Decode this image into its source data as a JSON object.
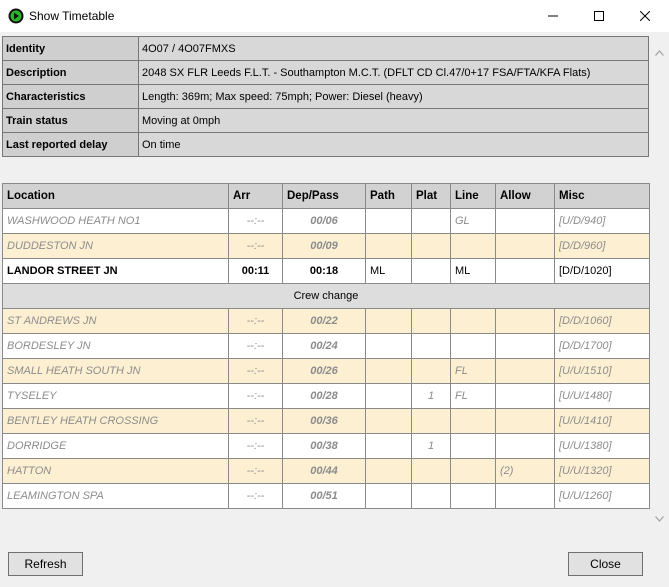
{
  "window": {
    "title": "Show Timetable"
  },
  "summary": [
    {
      "label": "Identity",
      "value": "4O07 / 4O07FMXS"
    },
    {
      "label": "Description",
      "value": "2048 SX FLR Leeds F.L.T. - Southampton M.C.T. (DFLT CD Cl.47/0+17 FSA/FTA/KFA Flats)"
    },
    {
      "label": "Characteristics",
      "value": "Length: 369m; Max speed: 75mph; Power: Diesel (heavy)"
    },
    {
      "label": "Train status",
      "value": "Moving at 0mph"
    },
    {
      "label": "Last reported delay",
      "value": "On time"
    }
  ],
  "columns": [
    "Location",
    "Arr",
    "Dep/Pass",
    "Path",
    "Plat",
    "Line",
    "Allow",
    "Misc"
  ],
  "crew_change": "Crew change",
  "rows": [
    {
      "location": "WASHWOOD HEATH NO1",
      "arr": "--:--",
      "dep": "00/06",
      "path": "",
      "plat": "",
      "line": "GL",
      "allow": "",
      "misc": "[U/D/940]"
    },
    {
      "location": "DUDDESTON JN",
      "arr": "--:--",
      "dep": "00/09",
      "path": "",
      "plat": "",
      "line": "",
      "allow": "",
      "misc": "[D/D/960]"
    },
    {
      "location": "LANDOR STREET JN",
      "arr": "00:11",
      "dep": "00:18",
      "path": "ML",
      "plat": "",
      "line": "ML",
      "allow": "",
      "misc": "[D/D/1020]"
    },
    {
      "location": "ST ANDREWS JN",
      "arr": "--:--",
      "dep": "00/22",
      "path": "",
      "plat": "",
      "line": "",
      "allow": "",
      "misc": "[D/D/1060]"
    },
    {
      "location": "BORDESLEY JN",
      "arr": "--:--",
      "dep": "00/24",
      "path": "",
      "plat": "",
      "line": "",
      "allow": "",
      "misc": "[D/D/1700]"
    },
    {
      "location": "SMALL HEATH SOUTH JN",
      "arr": "--:--",
      "dep": "00/26",
      "path": "",
      "plat": "",
      "line": "FL",
      "allow": "",
      "misc": "[U/U/1510]"
    },
    {
      "location": "TYSELEY",
      "arr": "--:--",
      "dep": "00/28",
      "path": "",
      "plat": "1",
      "line": "FL",
      "allow": "",
      "misc": "[U/U/1480]"
    },
    {
      "location": "BENTLEY HEATH CROSSING",
      "arr": "--:--",
      "dep": "00/36",
      "path": "",
      "plat": "",
      "line": "",
      "allow": "",
      "misc": "[U/U/1410]"
    },
    {
      "location": "DORRIDGE",
      "arr": "--:--",
      "dep": "00/38",
      "path": "",
      "plat": "1",
      "line": "",
      "allow": "",
      "misc": "[U/U/1380]"
    },
    {
      "location": "HATTON",
      "arr": "--:--",
      "dep": "00/44",
      "path": "",
      "plat": "",
      "line": "",
      "allow": "(2)",
      "misc": "[U/U/1320]"
    },
    {
      "location": "LEAMINGTON SPA",
      "arr": "--:--",
      "dep": "00/51",
      "path": "",
      "plat": "",
      "line": "",
      "allow": "",
      "misc": "[U/U/1260]"
    }
  ],
  "buttons": {
    "refresh": "Refresh",
    "close": "Close"
  },
  "icons": {
    "app": "green-train-icon",
    "min": "minimize-icon",
    "max": "maximize-icon",
    "close": "close-icon"
  },
  "colors": {
    "tan_row": "#fdf0d2",
    "header_gray": "#d2d2d2",
    "app_icon_green": "#2bb52b"
  }
}
